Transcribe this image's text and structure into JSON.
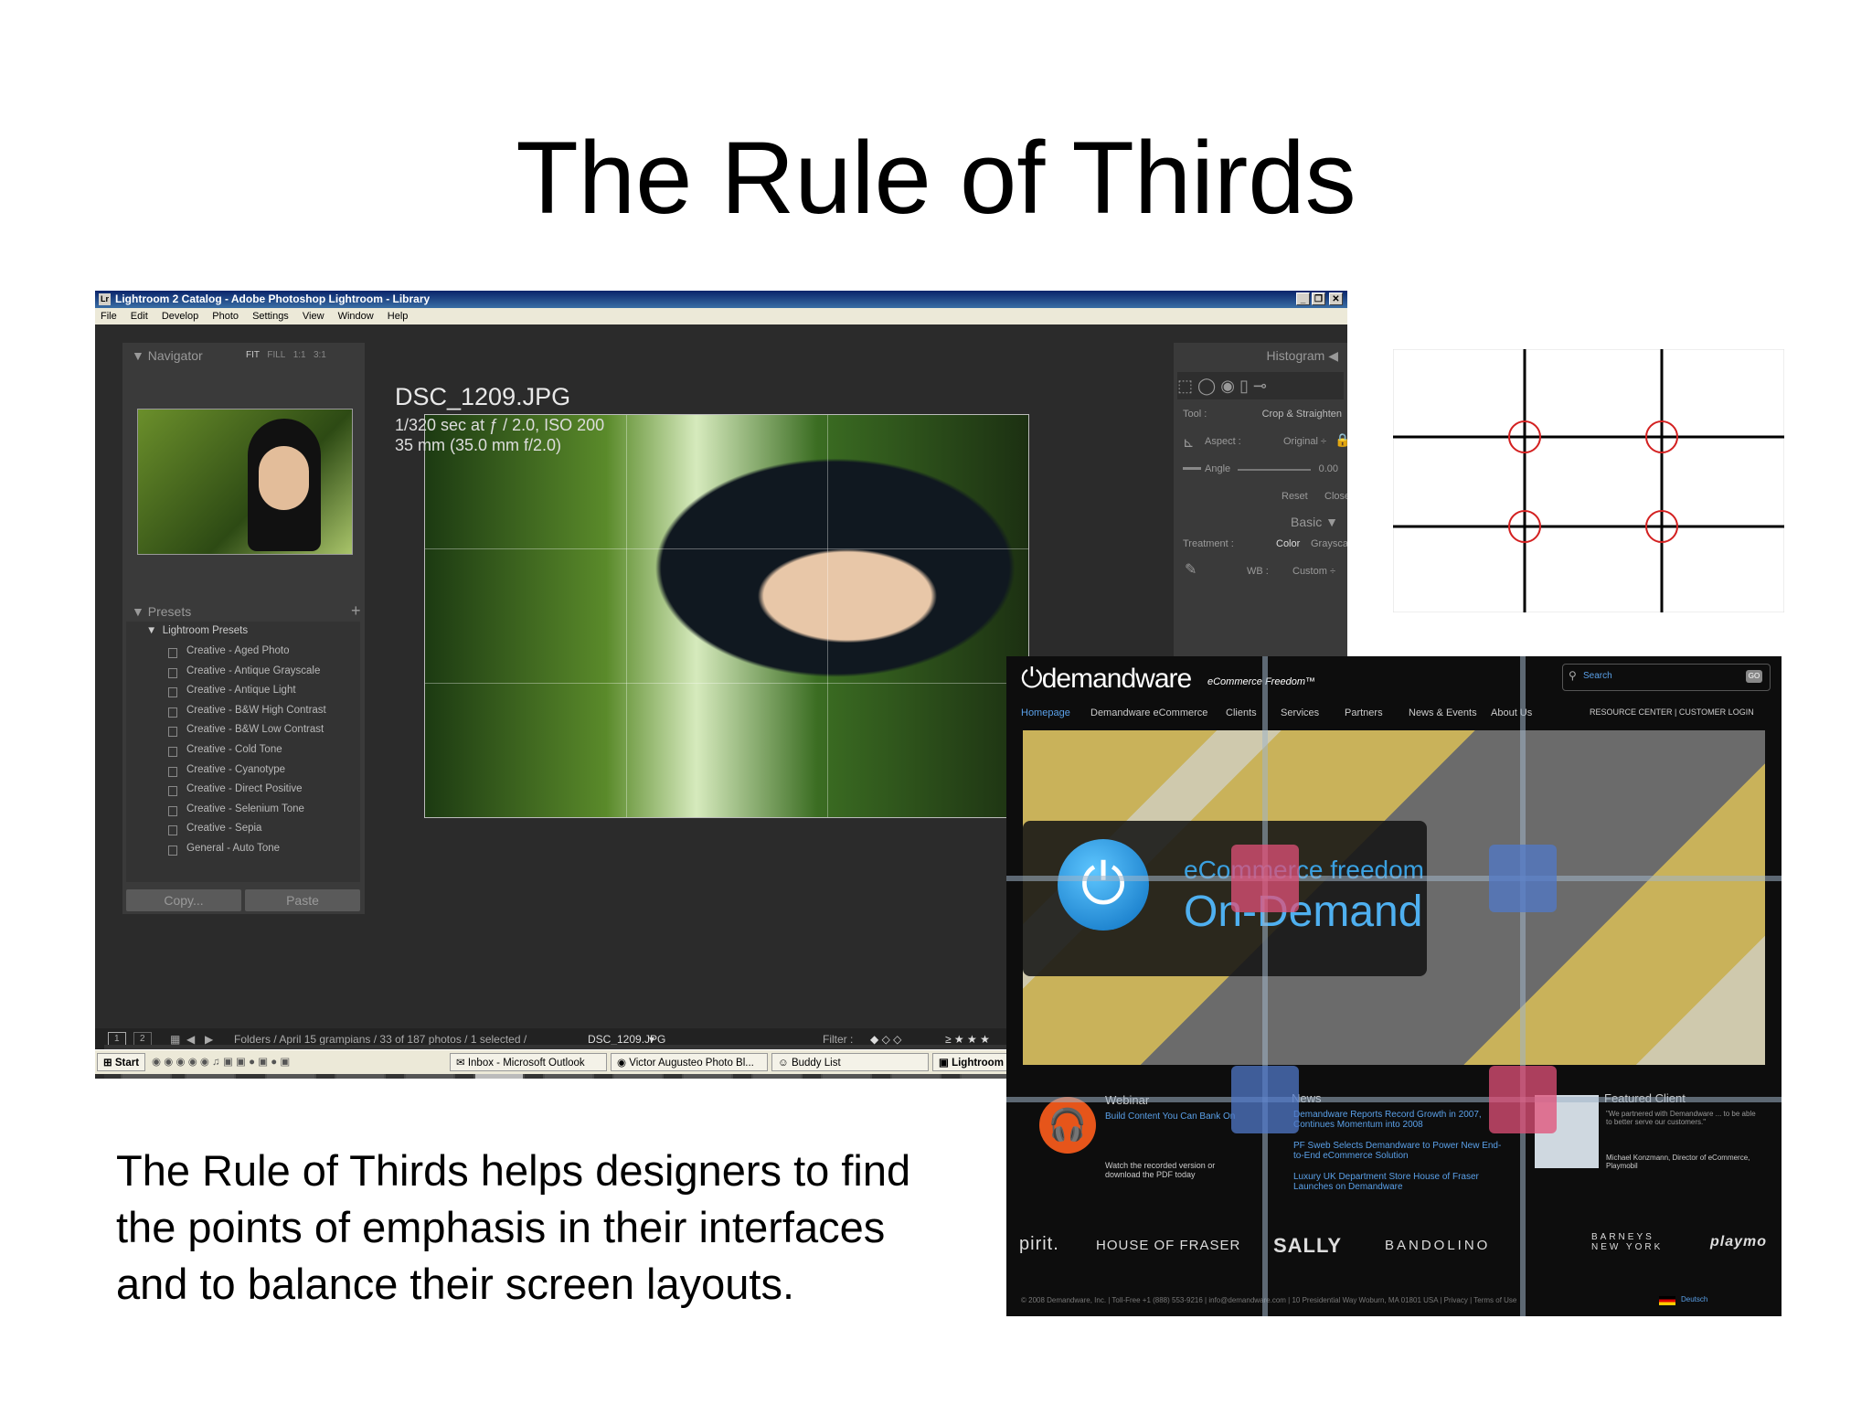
{
  "slide": {
    "title": "The Rule of Thirds",
    "body_line1": "The Rule of Thirds helps designers to find",
    "body_line2": "the points of emphasis in their interfaces",
    "body_line3": "and to balance their screen layouts."
  },
  "lightroom": {
    "window_title": "Lightroom 2 Catalog - Adobe Photoshop Lightroom - Library",
    "app_icon": "Lr",
    "menu": [
      "File",
      "Edit",
      "Develop",
      "Photo",
      "Settings",
      "View",
      "Window",
      "Help"
    ],
    "navigator_label": "Navigator",
    "nav_zoom": [
      "FIT",
      "FILL",
      "1:1",
      "3:1"
    ],
    "presets_label": "Presets",
    "presets_group": "Lightroom Presets",
    "presets": [
      "Creative - Aged Photo",
      "Creative - Antique Grayscale",
      "Creative - Antique Light",
      "Creative - B&W High Contrast",
      "Creative - B&W Low Contrast",
      "Creative - Cold Tone",
      "Creative - Cyanotype",
      "Creative - Direct Positive",
      "Creative - Selenium Tone",
      "Creative - Sepia",
      "General - Auto Tone"
    ],
    "copy_btn": "Copy...",
    "paste_btn": "Paste",
    "filename": "DSC_1209.JPG",
    "exif1": "1/320 sec at ƒ / 2.0, ISO 200",
    "exif2": "35 mm (35.0 mm f/2.0)",
    "histogram_label": "Histogram",
    "tool_label": "Tool :",
    "tool_value": "Crop & Straighten",
    "aspect_label": "Aspect :",
    "aspect_value": "Original ÷",
    "angle_label": "Angle",
    "angle_value": "0.00",
    "reset_btn": "Reset",
    "close_btn": "Close",
    "basic_label": "Basic",
    "treatment_label": "Treatment :",
    "treatment_color": "Color",
    "treatment_gray": "Grayscale",
    "wb_label": "WB :",
    "wb_value": "Custom ÷",
    "filter_label": "Filter :",
    "breadcrumb": "Folders / April 15 grampians / 33 of 187 photos / 1 selected / ",
    "breadcrumb_file": "DSC_1209.JPG",
    "view1": "1",
    "view2": "2"
  },
  "taskbar": {
    "start": "Start",
    "item1": "Inbox - Microsoft Outlook",
    "item2": "Victor Augusteo Photo Bl...",
    "item3": "Buddy List",
    "item4": "Lightroom"
  },
  "demandware": {
    "logo": "demandware",
    "tagline": "eCommerce Freedom™",
    "search_placeholder": "Search",
    "nav": [
      "Homepage",
      "Demandware eCommerce",
      "Clients",
      "Services",
      "Partners",
      "News & Events",
      "About Us"
    ],
    "nav_right": "RESOURCE CENTER  |  CUSTOMER LOGIN",
    "hero_line1": "eCommerce freedom",
    "hero_line2": "On-Demand",
    "webinar_title": "Webinar",
    "webinar_link": "Build Content You Can Bank On",
    "webinar_text": "Watch the recorded version or download the PDF today",
    "news_title": "News",
    "news1": "Demandware Reports Record Growth in 2007, Continues Momentum into 2008",
    "news2": "PF Sweb Selects Demandware to Power New End-to-End eCommerce Solution",
    "news3": "Luxury UK Department Store House of Fraser Launches on Demandware",
    "featured_title": "Featured Client",
    "featured_quote": "\"We partnered with Demandware ... to be able to better serve our customers.\"",
    "featured_person": "Michael Konzmann, Director of eCommerce, Playmobil",
    "brands": [
      "pirit.",
      "HOUSE OF FRASER",
      "SALLY",
      "BANDOLINO",
      "BARNEYS NEW YORK",
      "playmo"
    ],
    "footer": "© 2008 Demandware, Inc.  |  Toll-Free +1 (888) 553-9216  |  info@demandware.com  |  10 Presidential Way Woburn, MA 01801 USA  |  Privacy  |  Terms of Use",
    "footer_lang": "Deutsch"
  },
  "colors": {
    "thirds_grid": "#000000",
    "thirds_circle": "#d32020",
    "hot_pink": "#e15078",
    "hot_blue": "#5078c8"
  }
}
